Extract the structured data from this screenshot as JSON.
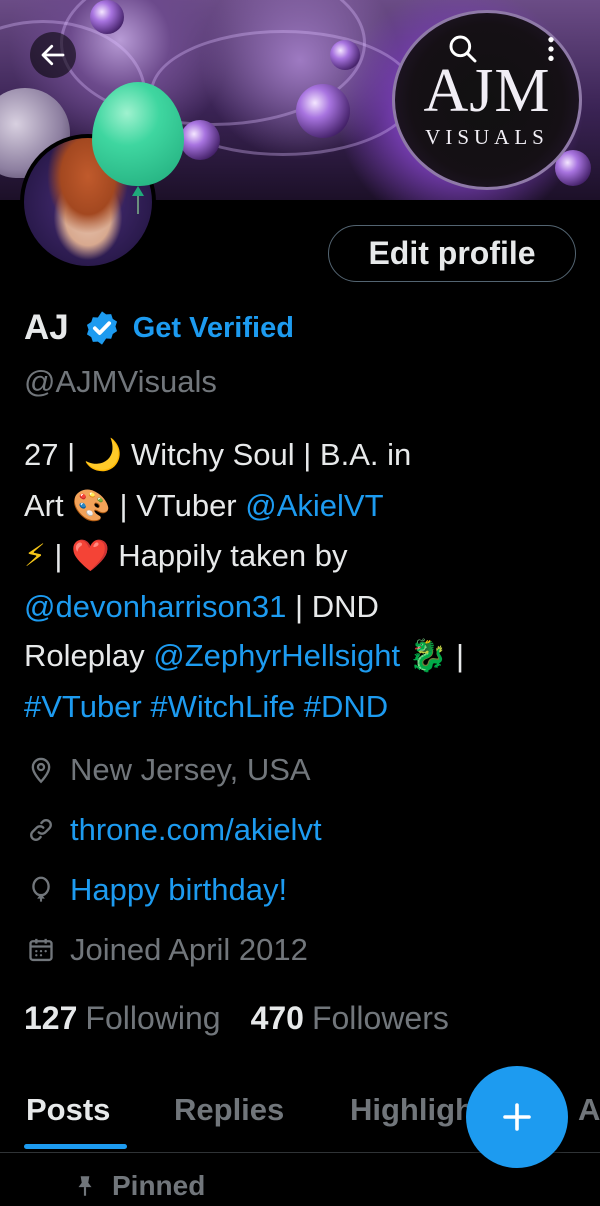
{
  "banner": {
    "logo_main": "AJM",
    "logo_sub": "VISUALS"
  },
  "header": {
    "back_icon": "arrow-left-icon",
    "search_icon": "search-icon",
    "more_icon": "more-vertical-icon"
  },
  "profile": {
    "edit_button": "Edit profile",
    "display_name": "AJ",
    "get_verified": "Get Verified",
    "handle": "@AJMVisuals",
    "bio": {
      "l1_text": "27 | ",
      "l1_emoji_moon": "🌙",
      "l1_rest": " Witchy Soul | B.A. in",
      "l2_text": "Art ",
      "l2_emoji_palette": "🎨",
      "l2_mid": " | VTuber ",
      "l2_link": "@AkielVT",
      "l3_emoji_bolt": "⚡",
      "l3_mid": " | ",
      "l3_emoji_heart": "❤️",
      "l3_rest": " Happily taken by",
      "l4_link": "@devonharrison31",
      "l4_rest": " | DND",
      "l5_text": "Roleplay ",
      "l5_link": "@ZephyrHellsight",
      "l5_emoji_dragon": "🐉",
      "l5_rest": " |",
      "l6_tag1": "#VTuber",
      "l6_tag2": "#WitchLife",
      "l6_tag3": "#DND"
    },
    "location": "New Jersey, USA",
    "website": "throne.com/akielvt",
    "birthday": "Happy birthday!",
    "joined": "Joined April 2012",
    "following_count": "127",
    "following_label": "Following",
    "followers_count": "470",
    "followers_label": "Followers"
  },
  "tabs": [
    {
      "label": "Posts",
      "active": true
    },
    {
      "label": "Replies",
      "active": false
    },
    {
      "label": "Highlights",
      "active": false
    },
    {
      "label": "Articles",
      "active": false
    }
  ],
  "pinned_label": "Pinned",
  "colors": {
    "accent": "#1d9bf0",
    "background": "#000000",
    "text": "#e7e9ea",
    "muted": "#71767b"
  }
}
